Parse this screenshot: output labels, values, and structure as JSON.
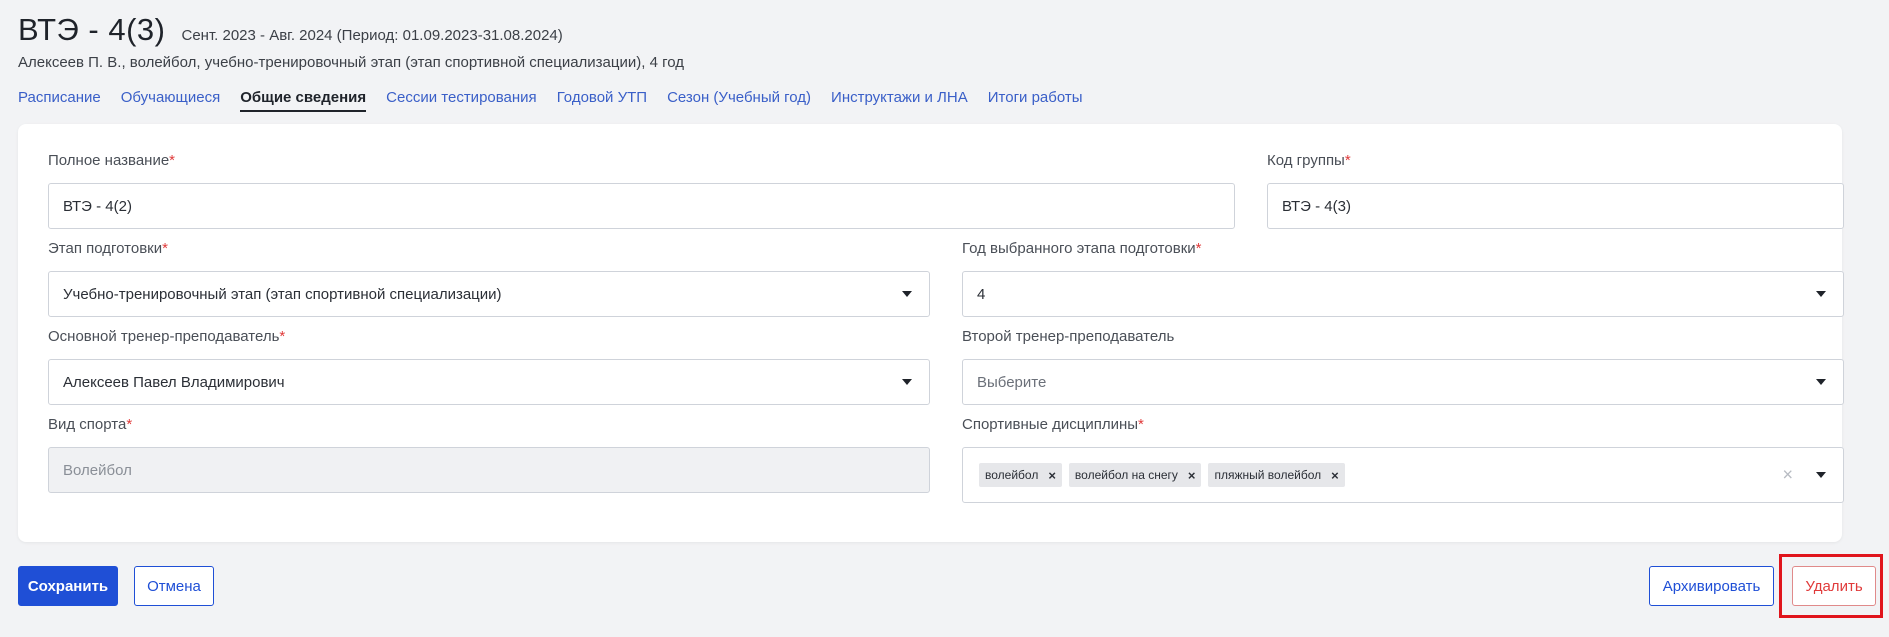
{
  "header": {
    "title": "ВТЭ - 4(3)",
    "period": "Сент. 2023 - Авг. 2024 (Период: 01.09.2023-31.08.2024)",
    "subtitle": "Алексеев П. В., волейбол, учебно-тренировочный этап (этап спортивной специализации), 4 год"
  },
  "tabs": [
    {
      "label": "Расписание",
      "active": false
    },
    {
      "label": "Обучающиеся",
      "active": false
    },
    {
      "label": "Общие сведения",
      "active": true
    },
    {
      "label": "Сессии тестирования",
      "active": false
    },
    {
      "label": "Годовой УТП",
      "active": false
    },
    {
      "label": "Сезон (Учебный год)",
      "active": false
    },
    {
      "label": "Инструктажи и ЛНА",
      "active": false
    },
    {
      "label": "Итоги работы",
      "active": false
    }
  ],
  "form": {
    "full_name": {
      "label": "Полное название",
      "required_mark": "*",
      "value": "ВТЭ - 4(2)"
    },
    "group_code": {
      "label": "Код группы",
      "required_mark": "*",
      "value": "ВТЭ - 4(3)"
    },
    "stage": {
      "label": "Этап подготовки",
      "required_mark": "*",
      "value": "Учебно-тренировочный этап (этап спортивной специализации)"
    },
    "stage_year": {
      "label": "Год выбранного этапа подготовки",
      "required_mark": "*",
      "value": "4"
    },
    "main_coach": {
      "label": "Основной тренер-преподаватель",
      "required_mark": "*",
      "value": "Алексеев Павел Владимирович"
    },
    "second_coach": {
      "label": "Второй тренер-преподаватель",
      "value": "Выберите"
    },
    "sport": {
      "label": "Вид спорта",
      "required_mark": "*",
      "value": "Волейбол"
    },
    "disciplines": {
      "label": "Спортивные дисциплины",
      "required_mark": "*",
      "chips": [
        "волейбол",
        "волейбол на снегу",
        "пляжный волейбол"
      ],
      "chip_remove": "×",
      "clear": "×"
    }
  },
  "actions": {
    "save": "Сохранить",
    "cancel": "Отмена",
    "archive": "Архивировать",
    "delete": "Удалить"
  },
  "colors": {
    "primary": "#1f4fd6",
    "danger": "#e03a3a",
    "highlight": "#e0141c"
  },
  "icons": {
    "dropdown": "caret-down-icon",
    "chip_remove": "close-icon",
    "clear": "clear-icon"
  }
}
